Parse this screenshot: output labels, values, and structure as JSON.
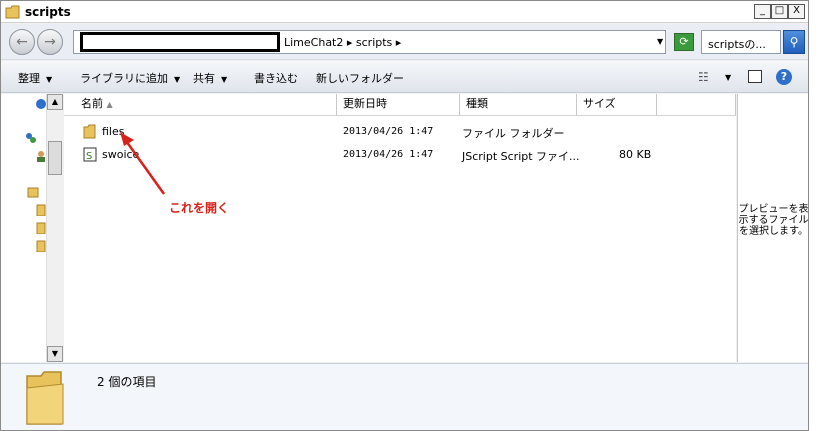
{
  "window": {
    "title": "scripts",
    "controls": {
      "minimize": "_",
      "maximize": "□",
      "close": "X"
    }
  },
  "address": {
    "path": "LimeChat2 ▸ scripts ▸",
    "search_placeholder": "scriptsの..."
  },
  "command_bar": {
    "organize": "整理",
    "include_in_library": "ライブラリに追加",
    "share": "共有",
    "burn": "書き込む",
    "new_folder": "新しいフォルダー"
  },
  "columns": {
    "name": "名前",
    "date_modified": "更新日時",
    "type": "種類",
    "size": "サイズ"
  },
  "files": [
    {
      "name": "files",
      "date": "2013/04/26 1:47",
      "type": "ファイル フォルダー",
      "size": "",
      "icon": "folder-icon"
    },
    {
      "name": "swoice",
      "date": "2013/04/26 1:47",
      "type": "JScript Script ファイ...",
      "size": "80 KB",
      "icon": "script-file-icon"
    }
  ],
  "annotation": {
    "text": "これを開く",
    "color": "#d6221a"
  },
  "preview": {
    "message": "プレビューを表示するファイルを選択します。"
  },
  "details": {
    "item_count": "2 個の項目"
  },
  "colors": {
    "folder_yellow": "#e8c25a",
    "accent_blue": "#2f6fc9",
    "annotation_red": "#d6221a"
  }
}
